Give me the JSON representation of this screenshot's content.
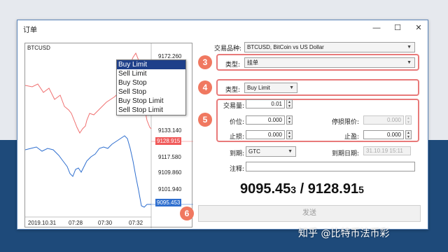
{
  "window": {
    "title": "订单",
    "minimize_glyph": "—",
    "maximize_glyph": "☐",
    "close_glyph": "✕"
  },
  "chart": {
    "symbol": "BTCUSD",
    "price_labels": [
      "9172.260",
      "9133.140",
      "9117.580",
      "9109.860",
      "9101.940"
    ],
    "ask_price": "9128.915",
    "bid_price": "9095.453",
    "time_labels": [
      "2019.10.31",
      "07:28",
      "07:30",
      "07:32"
    ],
    "colors": {
      "ask_line": "#f07070",
      "bid_line": "#2f6fcf"
    }
  },
  "order_type_menu": {
    "options": [
      "Buy Limit",
      "Sell Limit",
      "Buy Stop",
      "Sell Stop",
      "Buy Stop Limit",
      "Sell Stop Limit"
    ],
    "selected": "Buy Limit"
  },
  "form": {
    "symbol_label": "交易品种:",
    "symbol_value": "BTCUSD, BitCoin vs US Dollar",
    "type_label": "类型:",
    "type_value": "挂单",
    "order_type_label": "类型:",
    "order_type_value": "Buy Limit",
    "volume_label": "交易量:",
    "volume_value": "0.01",
    "price_label": "价位:",
    "price_value": "0.000",
    "stop_limit_label": "停损限价:",
    "stop_limit_value": "0.000",
    "sl_label": "止损:",
    "sl_value": "0.000",
    "tp_label": "止盈:",
    "tp_value": "0.000",
    "expiry_label": "到期:",
    "expiry_value": "GTC",
    "expiry_date_label": "到期日期:",
    "expiry_date_value": "31.10.19 15:11",
    "comment_label": "注释:",
    "comment_value": ""
  },
  "quote": {
    "bid_main": "9095.45",
    "bid_small": "3",
    "separator": " / ",
    "ask_main": "9128.91",
    "ask_small": "5"
  },
  "send_button": "发送",
  "badges": [
    "3",
    "4",
    "5",
    "6"
  ],
  "watermark": "知乎 @比特币法币彩"
}
